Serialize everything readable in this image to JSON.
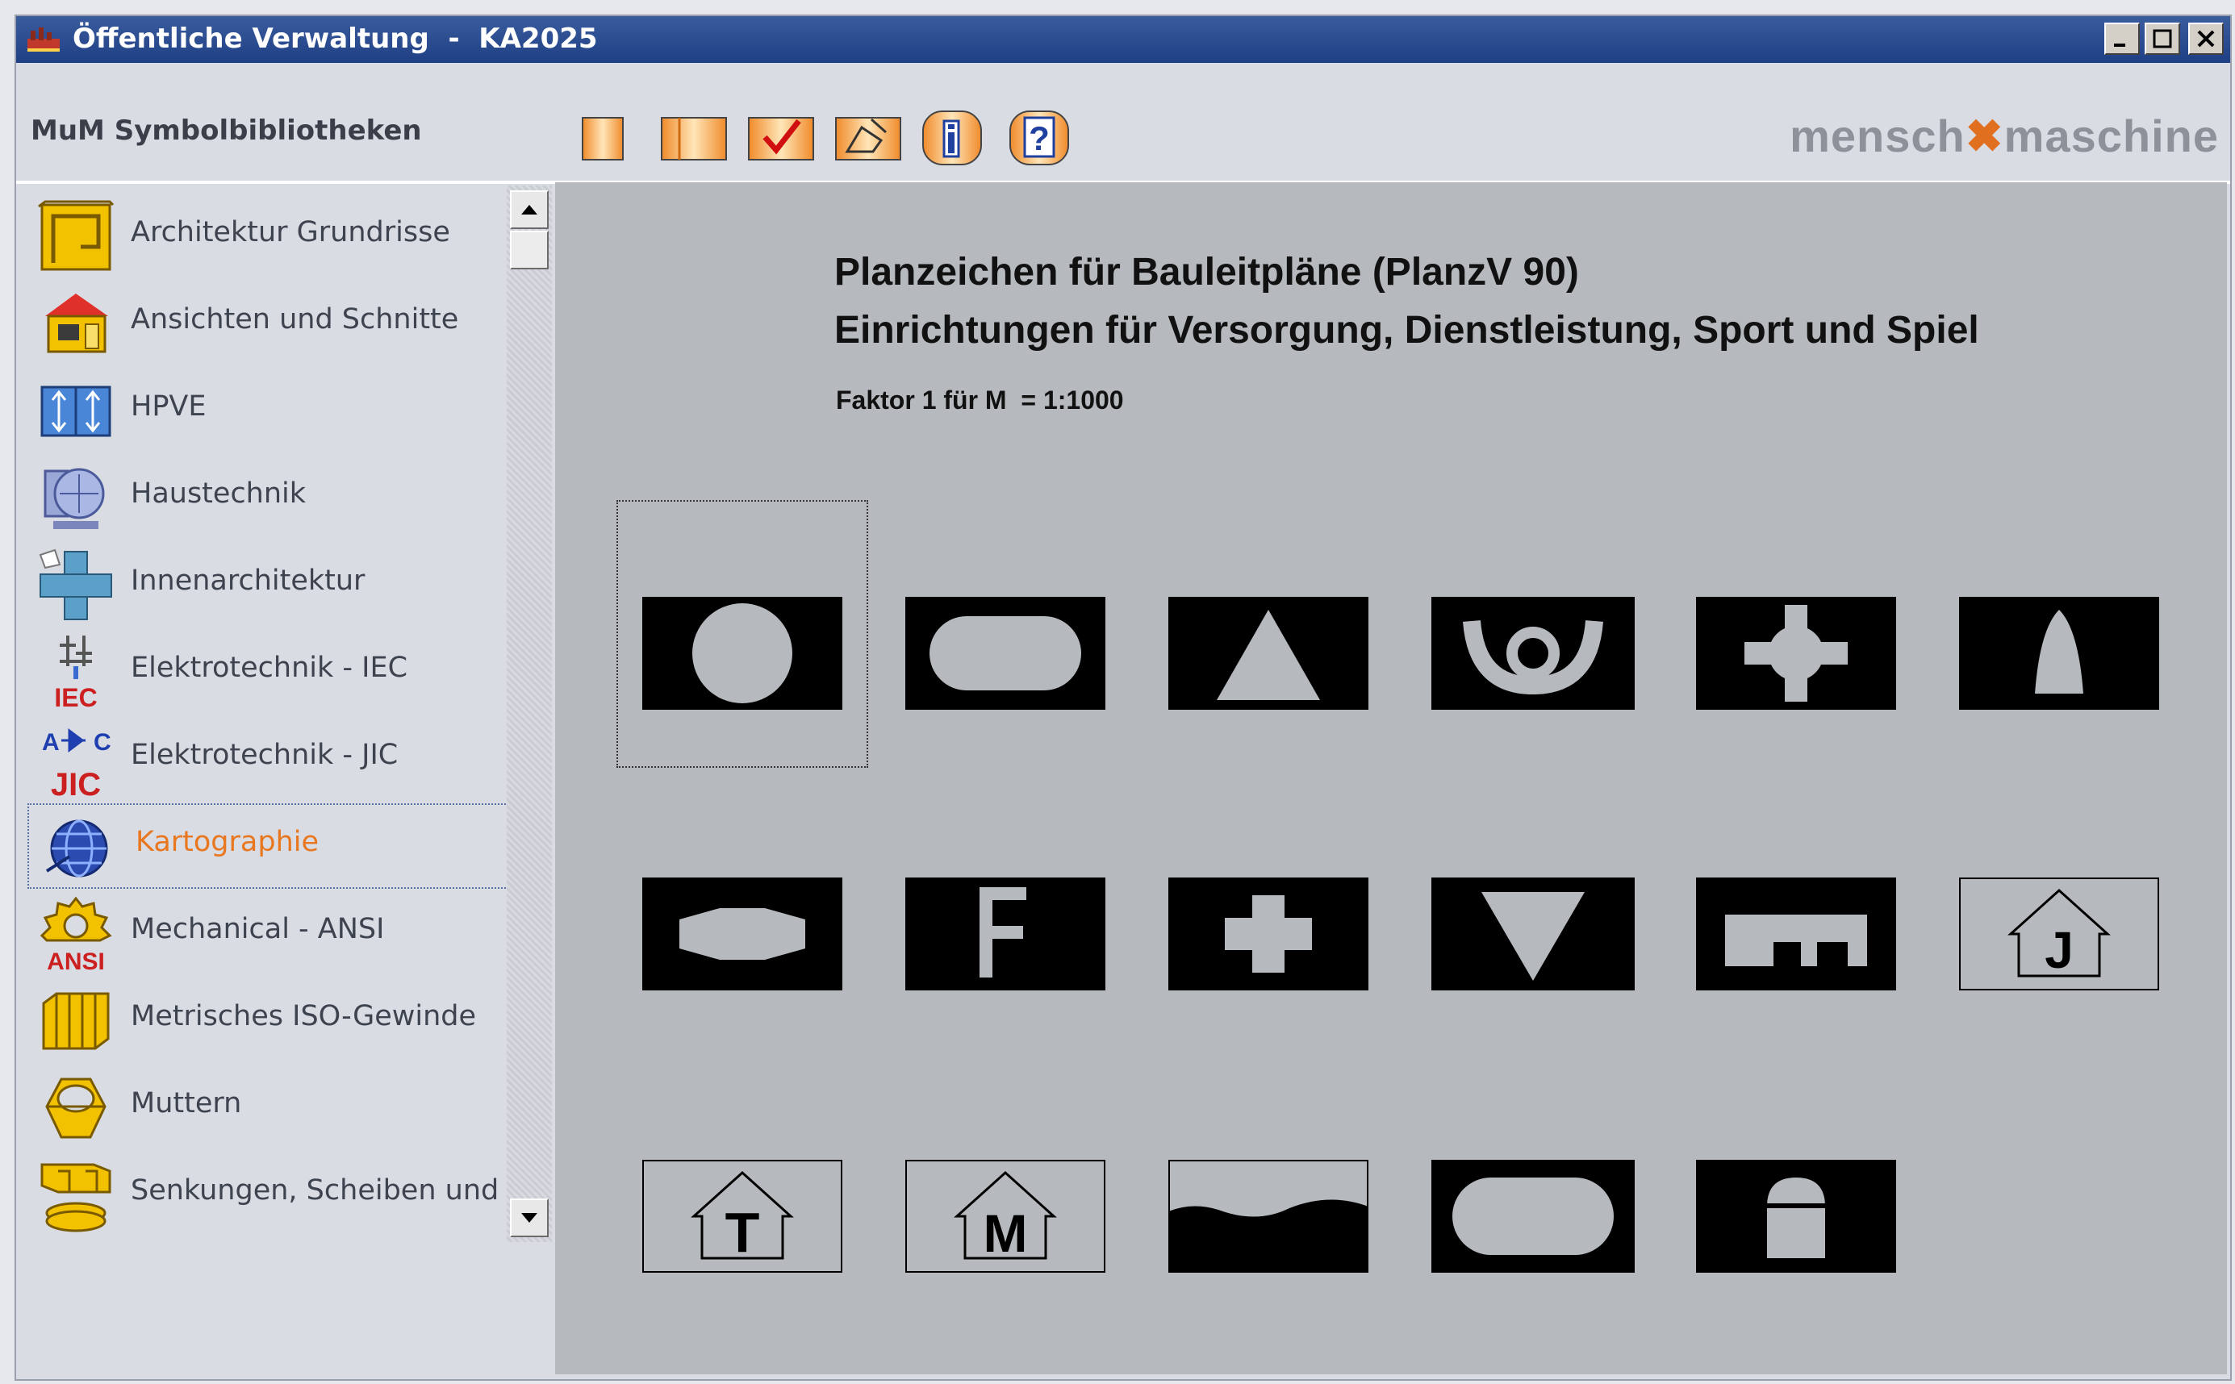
{
  "window": {
    "title": "Öffentliche Verwaltung  -  KA2025",
    "controls": [
      "minimize",
      "maximize",
      "close"
    ]
  },
  "toolbar": {
    "library_title": "MuM Symbolbibliotheken",
    "buttons": [
      {
        "name": "single-page-button",
        "icon": "page-icon"
      },
      {
        "name": "two-page-button",
        "icon": "two-pages-icon"
      },
      {
        "name": "check-button",
        "icon": "checkmark-icon"
      },
      {
        "name": "insert-symbol-button",
        "icon": "insert-icon"
      },
      {
        "name": "info-button",
        "icon": "info-icon"
      },
      {
        "name": "help-button",
        "icon": "help-icon"
      }
    ],
    "logo": {
      "left": "mensch",
      "right": "maschine",
      "accent": "#e07020"
    }
  },
  "sidebar": {
    "selected_index": 7,
    "items": [
      {
        "label": "Architektur Grundrisse",
        "icon": "floorplan-icon"
      },
      {
        "label": "Ansichten und Schnitte",
        "icon": "house-icon"
      },
      {
        "label": "HPVE",
        "icon": "hpve-icon"
      },
      {
        "label": "Haustechnik",
        "icon": "hvac-icon"
      },
      {
        "label": "Innenarchitektur",
        "icon": "interior-icon"
      },
      {
        "label": "Elektrotechnik - IEC",
        "icon": "iec-icon",
        "badge": "IEC"
      },
      {
        "label": "Elektrotechnik - JIC",
        "icon": "jic-icon",
        "badge": "JIC"
      },
      {
        "label": "Kartographie",
        "icon": "globe-icon"
      },
      {
        "label": "Mechanical - ANSI",
        "icon": "ansi-gear-icon",
        "badge": "ANSI"
      },
      {
        "label": "Metrisches ISO-Gewinde",
        "icon": "thread-icon"
      },
      {
        "label": "Muttern",
        "icon": "nut-icon"
      },
      {
        "label": "Senkungen, Scheiben und Du",
        "icon": "washer-icon"
      }
    ]
  },
  "content": {
    "heading_line1": "Planzeichen für Bauleitpläne (PlanzV 90)",
    "heading_line2": "Einrichtungen für Versorgung, Dienstleistung, Sport und Spiel",
    "factor": "Faktor 1 für M  = 1:1000",
    "symbols": [
      {
        "name": "circle-symbol",
        "letter": ""
      },
      {
        "name": "rounded-rect-symbol",
        "letter": ""
      },
      {
        "name": "triangle-symbol",
        "letter": ""
      },
      {
        "name": "posthorn-symbol",
        "letter": ""
      },
      {
        "name": "diamond-cross-symbol",
        "letter": ""
      },
      {
        "name": "bell-symbol",
        "letter": ""
      },
      {
        "name": "hexagon-symbol",
        "letter": ""
      },
      {
        "name": "letter-f-symbol",
        "letter": "F"
      },
      {
        "name": "cross-symbol",
        "letter": ""
      },
      {
        "name": "inverted-triangle-symbol",
        "letter": ""
      },
      {
        "name": "comb-symbol",
        "letter": ""
      },
      {
        "name": "house-j-symbol",
        "letter": "J"
      },
      {
        "name": "house-t-symbol",
        "letter": "T"
      },
      {
        "name": "house-m-symbol",
        "letter": "M"
      },
      {
        "name": "wave-symbol",
        "letter": ""
      },
      {
        "name": "rounded-rect-2-symbol",
        "letter": ""
      },
      {
        "name": "lock-symbol",
        "letter": ""
      }
    ]
  }
}
